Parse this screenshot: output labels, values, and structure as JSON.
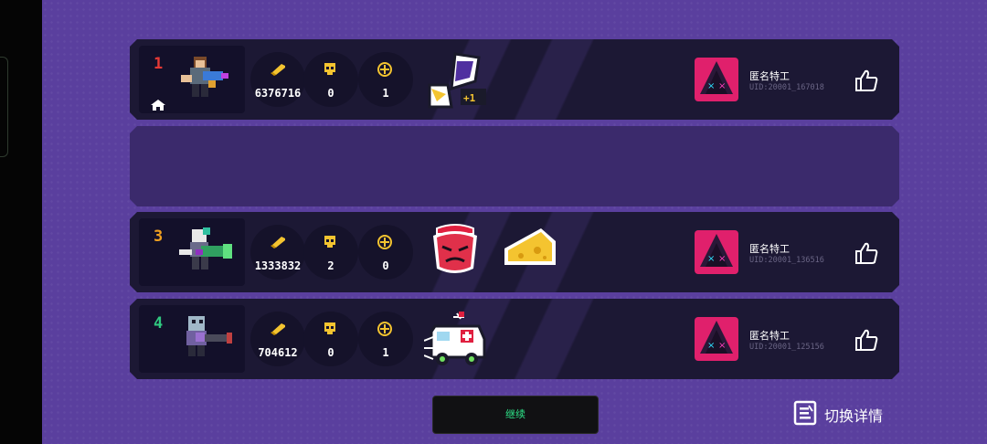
{
  "rows": [
    {
      "rank": "1",
      "rank_color": "#e53935",
      "bullets": "6376716",
      "kills": "0",
      "revives": "1",
      "player_name": "匿名特工",
      "player_uid": "UID:20001_167018",
      "is_host": true
    },
    {
      "empty": true
    },
    {
      "rank": "3",
      "rank_color": "#f0a020",
      "bullets": "1333832",
      "kills": "2",
      "revives": "0",
      "player_name": "匿名特工",
      "player_uid": "UID:20001_136516"
    },
    {
      "rank": "4",
      "rank_color": "#30c880",
      "bullets": "704612",
      "kills": "0",
      "revives": "1",
      "player_name": "匿名特工",
      "player_uid": "UID:20001_125156"
    }
  ],
  "continue_label": "继续",
  "switch_details_label": "切换详情",
  "icons": {
    "stat_1": "bullet-icon",
    "stat_2": "skull-icon",
    "stat_3": "revive-plus-icon",
    "like": "thumbs-up-icon",
    "switch": "document-switch-icon",
    "host": "home-icon"
  },
  "colors": {
    "bullets": "#f4c430",
    "kills": "#f4c430",
    "revives": "#f4c430",
    "continue_text": "#2ee68a",
    "avatar_bg": "#e0206c"
  }
}
